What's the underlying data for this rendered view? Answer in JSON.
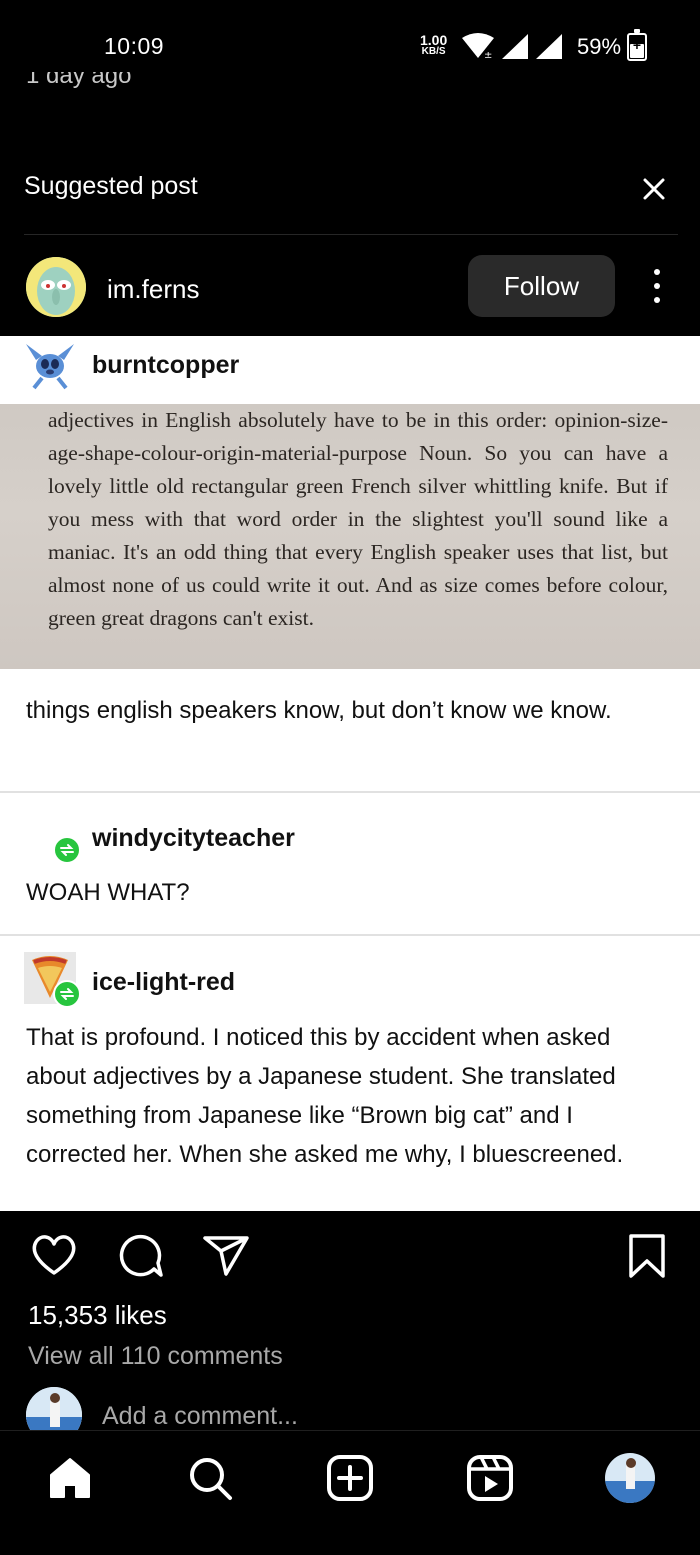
{
  "status_bar": {
    "time": "10:09",
    "net_speed_value": "1.00",
    "net_speed_unit": "KB/S",
    "battery": "59%"
  },
  "previous_post": {
    "time_ago": "1 day ago"
  },
  "suggested": {
    "label": "Suggested post"
  },
  "post": {
    "username": "im.ferns",
    "follow_label": "Follow",
    "likes": "15,353 likes",
    "view_comments": "View all 110 comments",
    "add_comment_placeholder": "Add a comment..."
  },
  "tumblr": {
    "op_user": "burntcopper",
    "book_excerpt": "adjectives in English absolutely have to be in this order: opinion-size-age-shape-colour-origin-material-purpose Noun. So you can have a lovely little old rectangular green French silver whittling knife. But if you mess with that word order in the slightest you'll sound like a maniac. It's an odd thing that every English speaker uses that list, but almost none of us could write it out. And as size comes before colour, green great dragons can't exist.",
    "op_caption": "things english speakers know, but don’t know we know.",
    "reply1_user": "windycityteacher",
    "reply1_text": "WOAH WHAT?",
    "reply2_user": "ice-light-red",
    "reply2_text": "That is profound. I noticed this by accident when asked about adjectives by a Japanese student. She translated something from Japanese like “Brown big cat” and I corrected her. When she asked me why, I bluescreened."
  },
  "icons": {
    "close": "close-icon",
    "more": "more-vertical-icon",
    "like": "heart-icon",
    "comment": "comment-icon",
    "share": "send-icon",
    "save": "bookmark-icon",
    "home": "home-icon",
    "search": "search-icon",
    "create": "plus-square-icon",
    "reels": "reels-icon",
    "profile": "profile-avatar"
  },
  "colors": {
    "background": "#000000",
    "follow_button": "#2a2a2a",
    "reblog_green": "#27c53e",
    "secondary_text": "#a8a8a8"
  }
}
